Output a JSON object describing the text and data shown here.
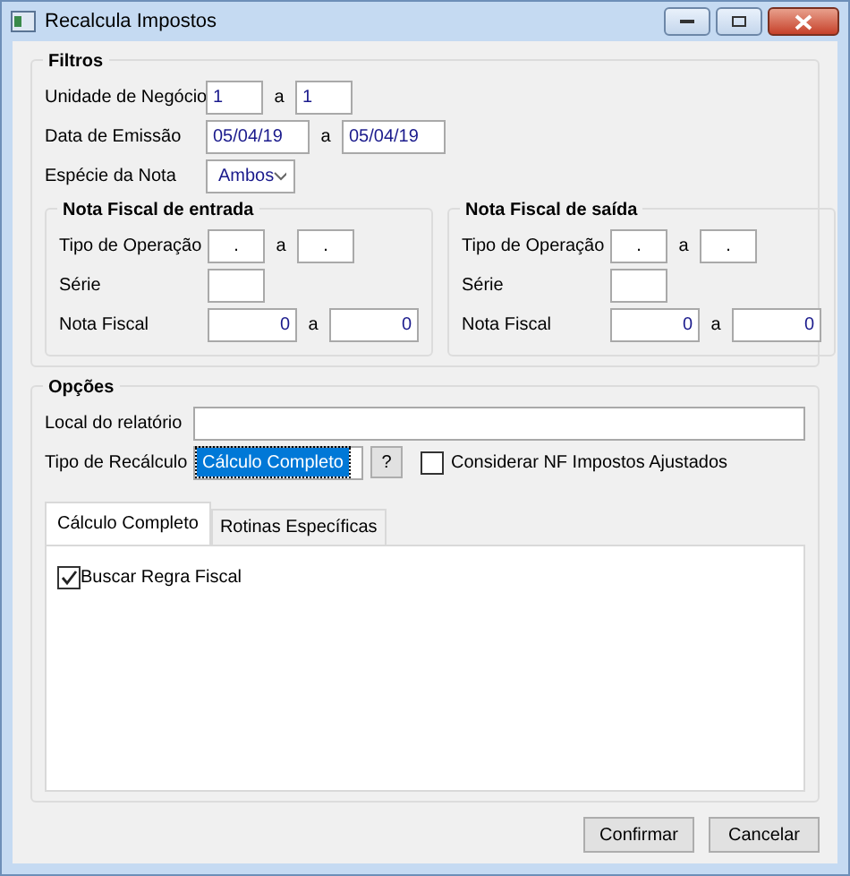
{
  "window": {
    "title": "Recalcula Impostos"
  },
  "filters": {
    "title": "Filtros",
    "rows": [
      {
        "kind": "short",
        "label": "Unidade de Negócio",
        "from": "1",
        "sep": "a",
        "to": "1"
      },
      {
        "kind": "date",
        "label": "Data de Emissão",
        "from": "05/04/19",
        "sep": "a",
        "to": "05/04/19"
      },
      {
        "kind": "select",
        "label": "Espécie da Nota",
        "value": "Ambos"
      }
    ],
    "groups": [
      {
        "title": "Nota Fiscal de entrada",
        "rows": [
          {
            "kind": "code",
            "label": "Tipo de Operação",
            "from": ".",
            "sep": "a",
            "to": "."
          },
          {
            "kind": "single",
            "label": "Série"
          },
          {
            "kind": "number",
            "label": "Nota Fiscal",
            "from": "0",
            "sep": "a",
            "to": "0"
          }
        ]
      },
      {
        "title": "Nota Fiscal de saída",
        "rows": [
          {
            "kind": "code",
            "label": "Tipo de Operação",
            "from": ".",
            "sep": "a",
            "to": "."
          },
          {
            "kind": "single",
            "label": "Série"
          },
          {
            "kind": "number",
            "label": "Nota Fiscal",
            "from": "0",
            "sep": "a",
            "to": "0"
          }
        ]
      }
    ]
  },
  "options": {
    "title": "Opções",
    "report_location": {
      "label": "Local do relatório"
    },
    "recalc_type": {
      "label": "Tipo de Recálculo",
      "value": "Cálculo Completo",
      "help": "?"
    },
    "adjusted": {
      "label": "Considerar NF Impostos Ajustados",
      "checked": false
    },
    "tabs": [
      {
        "label": "Cálculo Completo",
        "selected": true
      },
      {
        "label": "Rotinas Específicas",
        "selected": false
      }
    ],
    "fetch_rule": {
      "label": "Buscar Regra Fiscal",
      "checked": true
    }
  },
  "buttons": [
    "Confirmar",
    "Cancelar"
  ]
}
